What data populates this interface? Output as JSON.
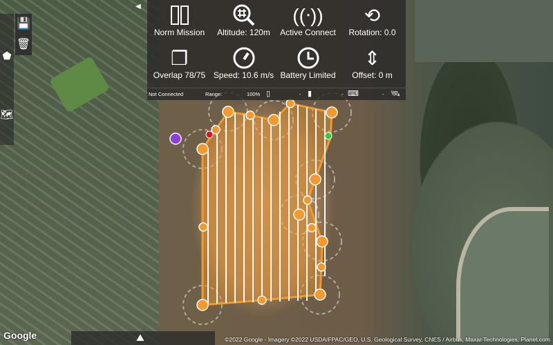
{
  "toolbar": {
    "items": [
      {
        "icon": "mission-path-icon",
        "label": "Norm Mission"
      },
      {
        "icon": "grid-magnifier-icon",
        "label": "Altitude: 120m"
      },
      {
        "icon": "antenna-icon",
        "label": "Active Connect"
      },
      {
        "icon": "crop-rotate-icon",
        "label": "Rotation: 0.0"
      },
      {
        "icon": "overlap-icon",
        "label": "Overlap 78/75"
      },
      {
        "icon": "speedometer-icon",
        "label": "Speed: 10.6 m/s"
      },
      {
        "icon": "clock-icon",
        "label": "Battery Limited"
      },
      {
        "icon": "vertical-arrows-icon",
        "label": "Offset: 0 m"
      }
    ],
    "status": {
      "connection": "Not Connected",
      "range_label": "Range:",
      "phone_battery": "100%",
      "drone_battery": "-",
      "remote": "-",
      "gps": "-"
    }
  },
  "map": {
    "google_logo": "Google",
    "attribution": "©2022 Google - Imagery ©2022 USDA/FPAC/GEO, U.S. Geological Survey, CNES / Airbus, Maxar Technologies, Planet.com"
  },
  "colors": {
    "mission": "#f39a2e",
    "home": "#8e3fe0",
    "start": "#2ecc40",
    "end": "#e0141e"
  }
}
